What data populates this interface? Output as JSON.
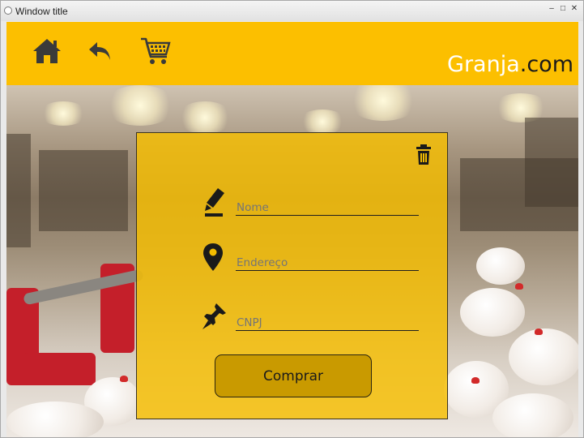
{
  "window": {
    "title": "Window title",
    "controls": [
      "minimize",
      "maximize",
      "close"
    ]
  },
  "header": {
    "nav": [
      {
        "name": "home",
        "icon": "home-icon"
      },
      {
        "name": "back",
        "icon": "back-arrow-icon"
      },
      {
        "name": "cart",
        "icon": "cart-icon"
      }
    ],
    "brand": {
      "name": "Granja",
      "suffix": ".com"
    },
    "colors": {
      "header_bg": "#fcbf00",
      "brand_text": "#ffffff",
      "brand_suffix": "#1a1a1a"
    }
  },
  "form": {
    "clear_icon": "trash-icon",
    "fields": [
      {
        "key": "nome",
        "placeholder": "Nome",
        "icon": "pen-icon",
        "value": ""
      },
      {
        "key": "endereco",
        "placeholder": "Endereço",
        "icon": "map-pin-icon",
        "value": ""
      },
      {
        "key": "cnpj",
        "placeholder": "CNPJ",
        "icon": "push-pin-icon",
        "value": ""
      }
    ],
    "submit_label": "Comprar",
    "colors": {
      "panel_bg": "#f6be00",
      "button_bg": "#c99a00"
    }
  },
  "background": {
    "scene": "poultry-farm-photo"
  }
}
